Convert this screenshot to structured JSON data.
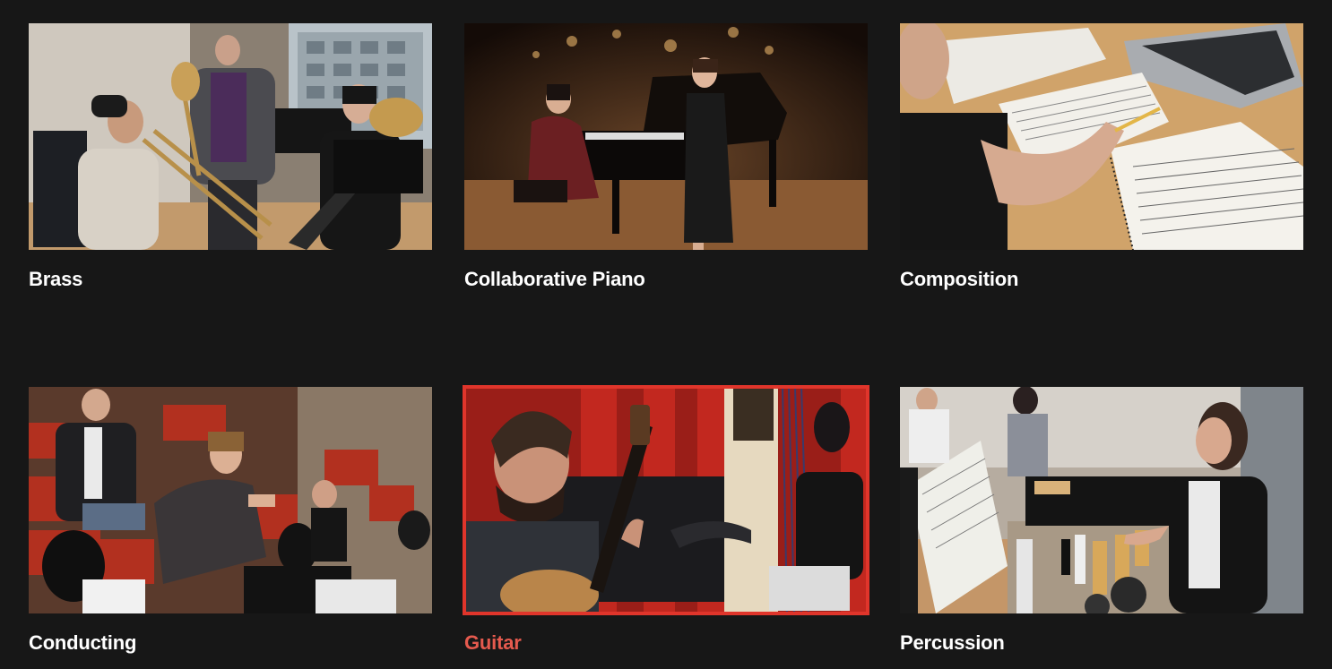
{
  "programs": [
    {
      "label": "Brass",
      "photo": "brass-lesson-photo"
    },
    {
      "label": "Collaborative Piano",
      "photo": "piano-recital-photo"
    },
    {
      "label": "Composition",
      "photo": "composition-score-photo"
    },
    {
      "label": "Conducting",
      "photo": "conducting-orchestra-photo"
    },
    {
      "label": "Guitar",
      "photo": "guitar-harp-photo",
      "active": true
    },
    {
      "label": "Percussion",
      "photo": "percussion-practice-photo"
    }
  ],
  "colors": {
    "background": "#171717",
    "label": "#ffffff",
    "active_label": "#e55a4e",
    "active_border": "#e0352b"
  }
}
